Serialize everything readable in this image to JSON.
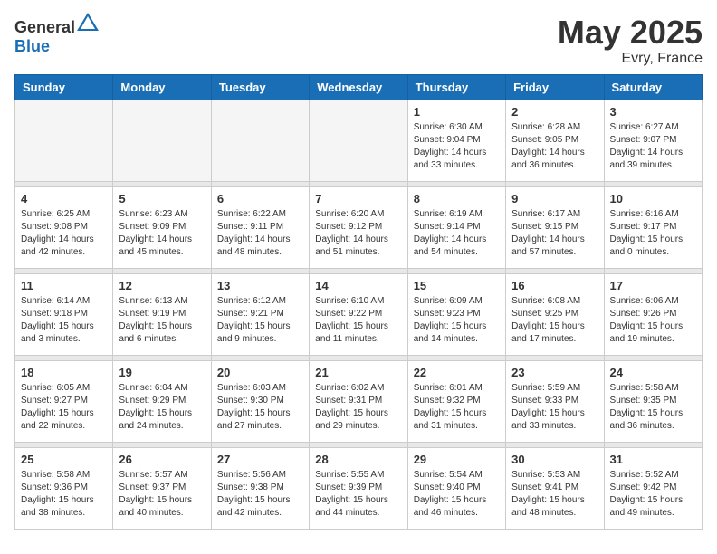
{
  "header": {
    "logo_general": "General",
    "logo_blue": "Blue",
    "month_year": "May 2025",
    "location": "Evry, France"
  },
  "weekdays": [
    "Sunday",
    "Monday",
    "Tuesday",
    "Wednesday",
    "Thursday",
    "Friday",
    "Saturday"
  ],
  "weeks": [
    [
      {
        "day": "",
        "empty": true
      },
      {
        "day": "",
        "empty": true
      },
      {
        "day": "",
        "empty": true
      },
      {
        "day": "",
        "empty": true
      },
      {
        "day": "1",
        "sunrise": "6:30 AM",
        "sunset": "9:04 PM",
        "daylight": "14 hours and 33 minutes."
      },
      {
        "day": "2",
        "sunrise": "6:28 AM",
        "sunset": "9:05 PM",
        "daylight": "14 hours and 36 minutes."
      },
      {
        "day": "3",
        "sunrise": "6:27 AM",
        "sunset": "9:07 PM",
        "daylight": "14 hours and 39 minutes."
      }
    ],
    [
      {
        "day": "4",
        "sunrise": "6:25 AM",
        "sunset": "9:08 PM",
        "daylight": "14 hours and 42 minutes."
      },
      {
        "day": "5",
        "sunrise": "6:23 AM",
        "sunset": "9:09 PM",
        "daylight": "14 hours and 45 minutes."
      },
      {
        "day": "6",
        "sunrise": "6:22 AM",
        "sunset": "9:11 PM",
        "daylight": "14 hours and 48 minutes."
      },
      {
        "day": "7",
        "sunrise": "6:20 AM",
        "sunset": "9:12 PM",
        "daylight": "14 hours and 51 minutes."
      },
      {
        "day": "8",
        "sunrise": "6:19 AM",
        "sunset": "9:14 PM",
        "daylight": "14 hours and 54 minutes."
      },
      {
        "day": "9",
        "sunrise": "6:17 AM",
        "sunset": "9:15 PM",
        "daylight": "14 hours and 57 minutes."
      },
      {
        "day": "10",
        "sunrise": "6:16 AM",
        "sunset": "9:17 PM",
        "daylight": "15 hours and 0 minutes."
      }
    ],
    [
      {
        "day": "11",
        "sunrise": "6:14 AM",
        "sunset": "9:18 PM",
        "daylight": "15 hours and 3 minutes."
      },
      {
        "day": "12",
        "sunrise": "6:13 AM",
        "sunset": "9:19 PM",
        "daylight": "15 hours and 6 minutes."
      },
      {
        "day": "13",
        "sunrise": "6:12 AM",
        "sunset": "9:21 PM",
        "daylight": "15 hours and 9 minutes."
      },
      {
        "day": "14",
        "sunrise": "6:10 AM",
        "sunset": "9:22 PM",
        "daylight": "15 hours and 11 minutes."
      },
      {
        "day": "15",
        "sunrise": "6:09 AM",
        "sunset": "9:23 PM",
        "daylight": "15 hours and 14 minutes."
      },
      {
        "day": "16",
        "sunrise": "6:08 AM",
        "sunset": "9:25 PM",
        "daylight": "15 hours and 17 minutes."
      },
      {
        "day": "17",
        "sunrise": "6:06 AM",
        "sunset": "9:26 PM",
        "daylight": "15 hours and 19 minutes."
      }
    ],
    [
      {
        "day": "18",
        "sunrise": "6:05 AM",
        "sunset": "9:27 PM",
        "daylight": "15 hours and 22 minutes."
      },
      {
        "day": "19",
        "sunrise": "6:04 AM",
        "sunset": "9:29 PM",
        "daylight": "15 hours and 24 minutes."
      },
      {
        "day": "20",
        "sunrise": "6:03 AM",
        "sunset": "9:30 PM",
        "daylight": "15 hours and 27 minutes."
      },
      {
        "day": "21",
        "sunrise": "6:02 AM",
        "sunset": "9:31 PM",
        "daylight": "15 hours and 29 minutes."
      },
      {
        "day": "22",
        "sunrise": "6:01 AM",
        "sunset": "9:32 PM",
        "daylight": "15 hours and 31 minutes."
      },
      {
        "day": "23",
        "sunrise": "5:59 AM",
        "sunset": "9:33 PM",
        "daylight": "15 hours and 33 minutes."
      },
      {
        "day": "24",
        "sunrise": "5:58 AM",
        "sunset": "9:35 PM",
        "daylight": "15 hours and 36 minutes."
      }
    ],
    [
      {
        "day": "25",
        "sunrise": "5:58 AM",
        "sunset": "9:36 PM",
        "daylight": "15 hours and 38 minutes."
      },
      {
        "day": "26",
        "sunrise": "5:57 AM",
        "sunset": "9:37 PM",
        "daylight": "15 hours and 40 minutes."
      },
      {
        "day": "27",
        "sunrise": "5:56 AM",
        "sunset": "9:38 PM",
        "daylight": "15 hours and 42 minutes."
      },
      {
        "day": "28",
        "sunrise": "5:55 AM",
        "sunset": "9:39 PM",
        "daylight": "15 hours and 44 minutes."
      },
      {
        "day": "29",
        "sunrise": "5:54 AM",
        "sunset": "9:40 PM",
        "daylight": "15 hours and 46 minutes."
      },
      {
        "day": "30",
        "sunrise": "5:53 AM",
        "sunset": "9:41 PM",
        "daylight": "15 hours and 48 minutes."
      },
      {
        "day": "31",
        "sunrise": "5:52 AM",
        "sunset": "9:42 PM",
        "daylight": "15 hours and 49 minutes."
      }
    ]
  ]
}
